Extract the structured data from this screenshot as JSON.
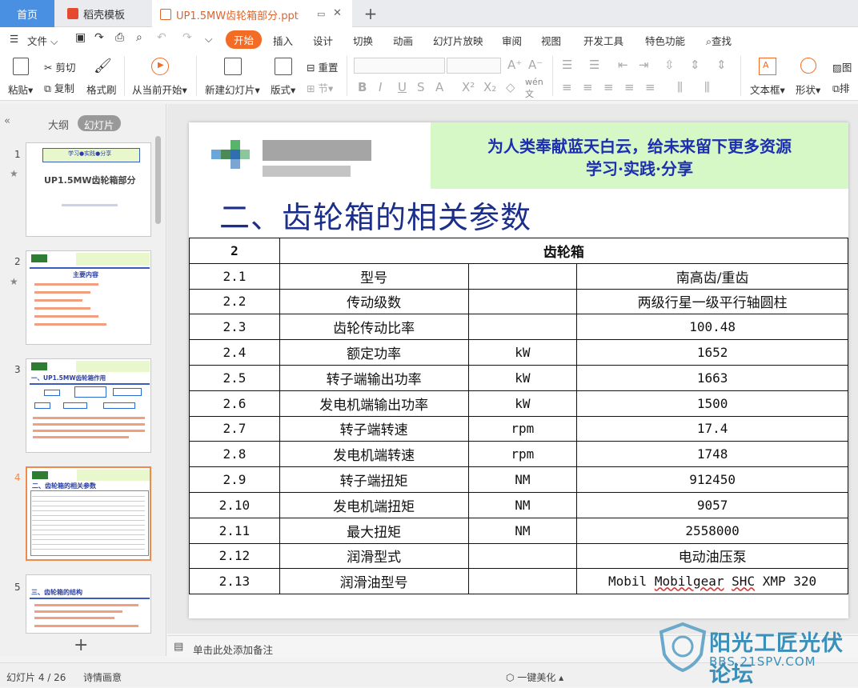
{
  "tabs": {
    "home": "首页",
    "template": "稻壳模板",
    "doc": "UP1.5MW齿轮箱部分.ppt"
  },
  "menu": {
    "file": "文件",
    "items": [
      "开始",
      "插入",
      "设计",
      "切换",
      "动画",
      "幻灯片放映",
      "审阅",
      "视图",
      "开发工具",
      "特色功能"
    ],
    "search": "查找"
  },
  "ribbon": {
    "paste": "粘贴",
    "cut": "剪切",
    "copy": "复制",
    "format_painter": "格式刷",
    "from_current": "从当前开始",
    "new_slide": "新建幻灯片",
    "layout": "版式",
    "reset": "重置",
    "section": "节",
    "textbox": "文本框",
    "shape": "形状",
    "picture": "图",
    "arrange": "排"
  },
  "leftpane": {
    "outline": "大纲",
    "slides": "幻灯片",
    "thumbs": [
      {
        "num": "1",
        "title": "UP1.5MW齿轮箱部分",
        "banner": "学习●实践●分享"
      },
      {
        "num": "2",
        "title": "主要内容"
      },
      {
        "num": "3",
        "title": "一、UP1.5MW齿轮箱作用"
      },
      {
        "num": "4",
        "title": "二、齿轮箱的相关参数"
      },
      {
        "num": "5",
        "title": "三、齿轮箱的结构"
      }
    ]
  },
  "slide": {
    "banner_line1": "为人类奉献蓝天白云，给未来留下更多资源",
    "banner_line2": "学习·实践·分享",
    "title": "二、齿轮箱的相关参数",
    "table": {
      "header": {
        "num": "2",
        "name": "齿轮箱"
      },
      "rows": [
        {
          "num": "2.1",
          "param": "型号",
          "unit": "",
          "value": "南高齿/重齿"
        },
        {
          "num": "2.2",
          "param": "传动级数",
          "unit": "",
          "value": "两级行星一级平行轴圆柱"
        },
        {
          "num": "2.3",
          "param": "齿轮传动比率",
          "unit": "",
          "value": "100.48"
        },
        {
          "num": "2.4",
          "param": "额定功率",
          "unit": "kW",
          "value": "1652"
        },
        {
          "num": "2.5",
          "param": "转子端输出功率",
          "unit": "kW",
          "value": "1663"
        },
        {
          "num": "2.6",
          "param": "发电机端输出功率",
          "unit": "kW",
          "value": "1500"
        },
        {
          "num": "2.7",
          "param": "转子端转速",
          "unit": "rpm",
          "value": "17.4"
        },
        {
          "num": "2.8",
          "param": "发电机端转速",
          "unit": "rpm",
          "value": "1748"
        },
        {
          "num": "2.9",
          "param": "转子端扭矩",
          "unit": "NM",
          "value": "912450"
        },
        {
          "num": "2.10",
          "param": "发电机端扭矩",
          "unit": "NM",
          "value": "9057"
        },
        {
          "num": "2.11",
          "param": "最大扭矩",
          "unit": "NM",
          "value": "2558000"
        },
        {
          "num": "2.12",
          "param": "润滑型式",
          "unit": "",
          "value": "电动油压泵"
        },
        {
          "num": "2.13",
          "param": "润滑油型号",
          "unit": "",
          "value": "Mobil Mobilgear SHC XMP 320"
        }
      ]
    }
  },
  "notes": {
    "placeholder": "单击此处添加备注"
  },
  "status": {
    "slide_counter": "幻灯片 4 / 26",
    "theme": "诗情画意",
    "beautify": "一键美化"
  },
  "watermark": {
    "title": "阳光工匠光伏论坛",
    "url": "BBS.21SPV.COM"
  },
  "colors": {
    "accent": "#f36c25",
    "title_blue": "#1a2e8a",
    "banner_green": "#d6f7c6",
    "banner_text": "#1d2fb0"
  }
}
